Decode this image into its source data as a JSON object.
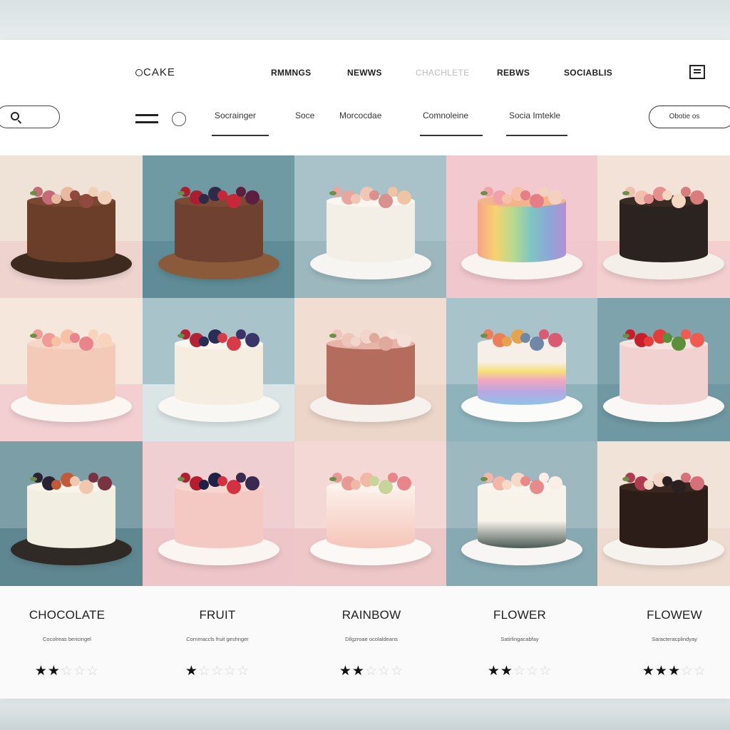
{
  "brand": {
    "logo": "CAKE"
  },
  "nav": {
    "links": [
      {
        "label": "RMMNGS",
        "dim": false
      },
      {
        "label": "NEWWS",
        "dim": false
      },
      {
        "label": "CHACHLETE",
        "dim": true
      },
      {
        "label": "REBWS",
        "dim": false
      },
      {
        "label": "SOCIABLIS",
        "dim": false
      }
    ]
  },
  "subnav": {
    "tabs": [
      {
        "label": "Socrainger",
        "underlined": true
      },
      {
        "label": "Soce",
        "underlined": false
      },
      {
        "label": "Morcocdae",
        "underlined": false
      },
      {
        "label": "Comnoleine",
        "underlined": true
      },
      {
        "label": "Socia Imtekle",
        "underlined": true
      }
    ],
    "cta_label": "Obotie os"
  },
  "tiles": [
    {
      "name": "chocolate-floral-cake",
      "wall": "#efe3d8",
      "floor": "#eed3cf",
      "cake": "#6b3e2a",
      "top": "#7a4732",
      "plate": "#3f2a20",
      "deco": [
        "#c46c74",
        "#e8b9a0",
        "#8f4a3d",
        "#f1d0b8"
      ]
    },
    {
      "name": "chocolate-berry-cake",
      "wall": "#6f99a3",
      "floor": "#5f8c96",
      "cake": "#6e4130",
      "top": "#7b4a35",
      "plate": "#8a5a3a",
      "deco": [
        "#a82030",
        "#2e2a4a",
        "#c6283a",
        "#5b2040"
      ]
    },
    {
      "name": "white-ribbed-floral-cake",
      "wall": "#a9c2c9",
      "floor": "#9cb8be",
      "cake": "#f4efe6",
      "top": "#faf6ef",
      "plate": "#f7f5f1",
      "deco": [
        "#e7a7a0",
        "#f1c6b5",
        "#d9918e",
        "#eec4a2"
      ]
    },
    {
      "name": "rainbow-striped-cake",
      "wall": "#f2c9cf",
      "floor": "#efc7cd",
      "cake": "linear-gradient(90deg,#f4a48a,#f7d26f,#b9da8e,#7fc6c1,#8aa8d8,#b48fd2)",
      "top": "#f3b48c",
      "plate": "#faf4f1",
      "deco": [
        "#f0a2a8",
        "#f6c1a8",
        "#e57e86",
        "#f3d1bf"
      ]
    },
    {
      "name": "dark-ribbed-floral-cake",
      "wall": "#f2e2d7",
      "floor": "#f4cfd0",
      "cake": "#2a2320",
      "top": "#3a2b25",
      "plate": "#f4efe9",
      "deco": [
        "#f0bfae",
        "#e58f91",
        "#f5d7c2",
        "#d97c7c"
      ]
    },
    {
      "name": "peach-quilted-floral-cake",
      "wall": "#f6e7dc",
      "floor": "#f3cfd2",
      "cake": "#f3c9b8",
      "top": "#f6d6c6",
      "plate": "#fbf6f2",
      "deco": [
        "#ef9c98",
        "#f6c1a4",
        "#e9848c",
        "#f9d4bd"
      ]
    },
    {
      "name": "white-grid-berry-cake",
      "wall": "#a8c3ca",
      "floor": "#dbe5e6",
      "cake": "#f5ede0",
      "top": "#faf5ec",
      "plate": "#f9f7f3",
      "deco": [
        "#b42236",
        "#2a2e55",
        "#d73b47",
        "#3a3468"
      ]
    },
    {
      "name": "two-tier-pink-geometric-cake",
      "wall": "#f1ddd2",
      "floor": "#ecd5c9",
      "cake": "#b46d5c",
      "top": "#e8b4a7",
      "plate": "#f6f1ec",
      "deco": [
        "#edc5ba",
        "#f1d5cb",
        "#dfa99c",
        "#f4e0d8"
      ]
    },
    {
      "name": "pastel-rainbow-rose-cake",
      "wall": "#a9c3cb",
      "floor": "#8eb3bb",
      "cake": "linear-gradient(180deg,#f6efe8 0%,#f6efe8 30%,#f6e07a 45%,#f0a7c0 60%,#b9a7e0 78%,#8fc2e8 100%)",
      "top": "#f6efe8",
      "plate": "#fbfbfa",
      "deco": [
        "#ea7f59",
        "#e7a24d",
        "#6f88a8",
        "#d95a71"
      ]
    },
    {
      "name": "pink-textured-strawberry-cake",
      "wall": "#7fa3ad",
      "floor": "#6f98a2",
      "cake": "#f2d2d0",
      "top": "#f6e3e0",
      "plate": "#f9f8f6",
      "deco": [
        "#c81d2b",
        "#e43b3b",
        "#5b8f3a",
        "#f25a50"
      ]
    },
    {
      "name": "white-ribbed-rose-cake",
      "wall": "#7b9ea7",
      "floor": "#5f8791",
      "cake": "#f3eee2",
      "top": "#f8f4ea",
      "plate": "#2f2a26",
      "deco": [
        "#2a2232",
        "#c25a3a",
        "#f0c8b0",
        "#7a3340"
      ]
    },
    {
      "name": "pink-ruffle-berry-cake",
      "wall": "#f0cfd2",
      "floor": "#eec6ca",
      "cake": "#f5c9c3",
      "top": "#f7d6cf",
      "plate": "#fbf5f2",
      "deco": [
        "#b21e30",
        "#1f2145",
        "#d43040",
        "#3a2a50"
      ]
    },
    {
      "name": "pink-ombre-floral-cake",
      "wall": "#f3d8d5",
      "floor": "#eec7c8",
      "cake": "linear-gradient(180deg,#fbf0e9 0%,#f6c5b8 100%)",
      "top": "#fbf2ec",
      "plate": "#fbf8f6",
      "deco": [
        "#e79a93",
        "#f1b9a5",
        "#c7d49c",
        "#e8868c"
      ]
    },
    {
      "name": "dark-band-floral-wreath-cake",
      "wall": "#9db8bf",
      "floor": "#87a9b2",
      "cake": "linear-gradient(180deg,#f7f2ea 0%,#f7f2ea 55%,#4b5a55 100%)",
      "top": "#f8f4ee",
      "plate": "#f7f6f4",
      "deco": [
        "#f2b6a8",
        "#f6d9c7",
        "#e88a8a",
        "#fbeee6"
      ]
    },
    {
      "name": "dark-chocolate-rose-cake",
      "wall": "#f1e3d8",
      "floor": "#eddbd0",
      "cake": "#2d1d18",
      "top": "#3a2720",
      "plate": "#f6f3ef",
      "deco": [
        "#b03a4f",
        "#f2d6c6",
        "#2a2020",
        "#d6707a"
      ]
    }
  ],
  "products": [
    {
      "title": "CHOCOLATE",
      "desc": "Cocolreas bericingel",
      "rating": 2,
      "max": 5,
      "first_star": "filled"
    },
    {
      "title": "FRUIT",
      "desc": "Cornmaccls fruit geshnger",
      "rating": 1,
      "max": 5,
      "first_star": "filled"
    },
    {
      "title": "RAINBOW",
      "desc": "Dilgzroae ocolaldeans",
      "rating": 2,
      "max": 5,
      "first_star": "filled"
    },
    {
      "title": "FLOWER",
      "desc": "Satirlingacabfay",
      "rating": 2,
      "max": 5,
      "first_star": "filled"
    },
    {
      "title": "FLOWEW",
      "desc": "Saracteracplindyay",
      "rating": 3,
      "max": 5,
      "first_star": "filled"
    }
  ]
}
